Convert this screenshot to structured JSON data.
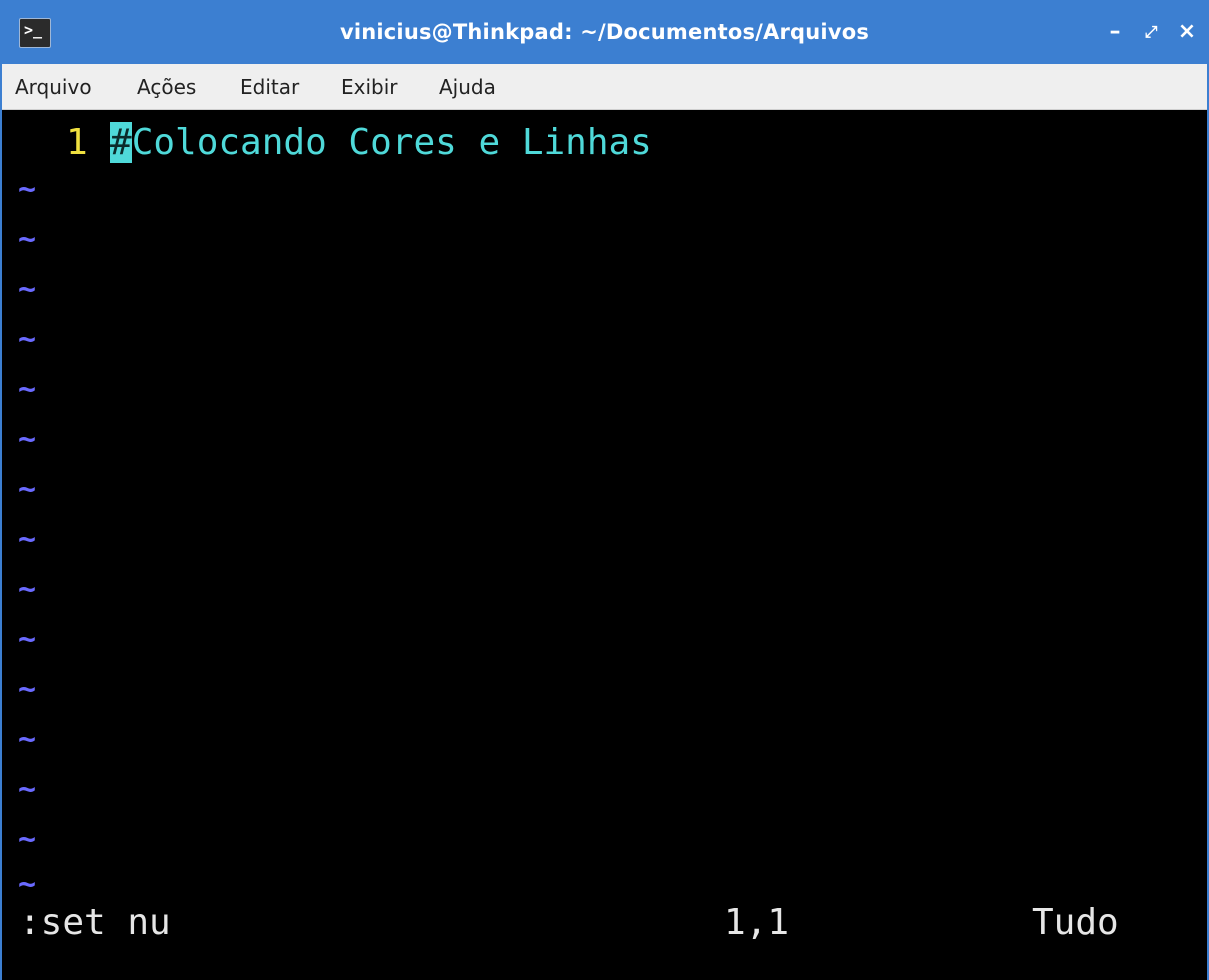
{
  "window": {
    "title": "vinicius@Thinkpad: ~/Documentos/Arquivos",
    "icon_glyph": ">_",
    "buttons": {
      "minimize": "–",
      "maximize": "⤢",
      "close": "×"
    },
    "accent_color": "#3c7fd1"
  },
  "menu": {
    "items": [
      "Arquivo",
      "Ações",
      "Editar",
      "Exibir",
      "Ajuda"
    ]
  },
  "editor": {
    "lines": [
      {
        "number": "1",
        "cursor_char": "#",
        "text": "Colocando Cores e Linhas"
      }
    ],
    "empty_line_marker": "~",
    "empty_line_count": 15,
    "colors": {
      "line_number": "#f0e040",
      "text": "#4fd9d9",
      "tilde": "#6a6aff",
      "background": "#000000"
    }
  },
  "statusline": {
    "command": ":set nu",
    "position": "1,1",
    "scroll": "Tudo"
  }
}
